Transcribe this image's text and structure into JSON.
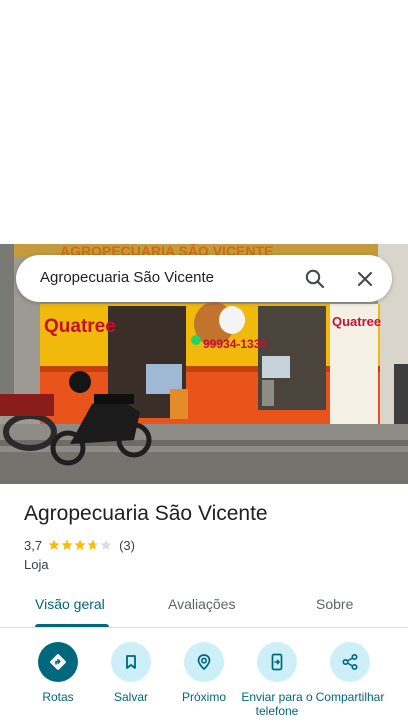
{
  "search": {
    "query": "Agropecuaria São Vicente",
    "search_icon": "search-icon",
    "close_icon": "close-icon"
  },
  "photo": {
    "sign_top": "AGROPECUARIA SÃO VICENTE",
    "brand_left": "Quatree",
    "brand_right": "Quatree",
    "phone": "99934-1330"
  },
  "place": {
    "name": "Agropecuaria São Vicente",
    "rating": "3,7",
    "stars": 3.7,
    "review_count": "(3)",
    "category": "Loja"
  },
  "tabs": [
    {
      "label": "Visão geral",
      "active": true
    },
    {
      "label": "Avaliações",
      "active": false
    },
    {
      "label": "Sobre",
      "active": false
    }
  ],
  "actions": [
    {
      "label": "Rotas",
      "icon": "directions-icon"
    },
    {
      "label": "Salvar",
      "icon": "bookmark-icon"
    },
    {
      "label": "Próximo",
      "icon": "nearby-icon"
    },
    {
      "label": "Enviar para o telefone",
      "icon": "send-to-phone-icon"
    },
    {
      "label": "Compartilhar",
      "icon": "share-icon"
    }
  ],
  "colors": {
    "accent": "#00677d",
    "action_bg": "#cdeff7",
    "star": "#fbbc04",
    "storefront_yellow": "#f2b90d",
    "storefront_orange": "#e8541c"
  }
}
